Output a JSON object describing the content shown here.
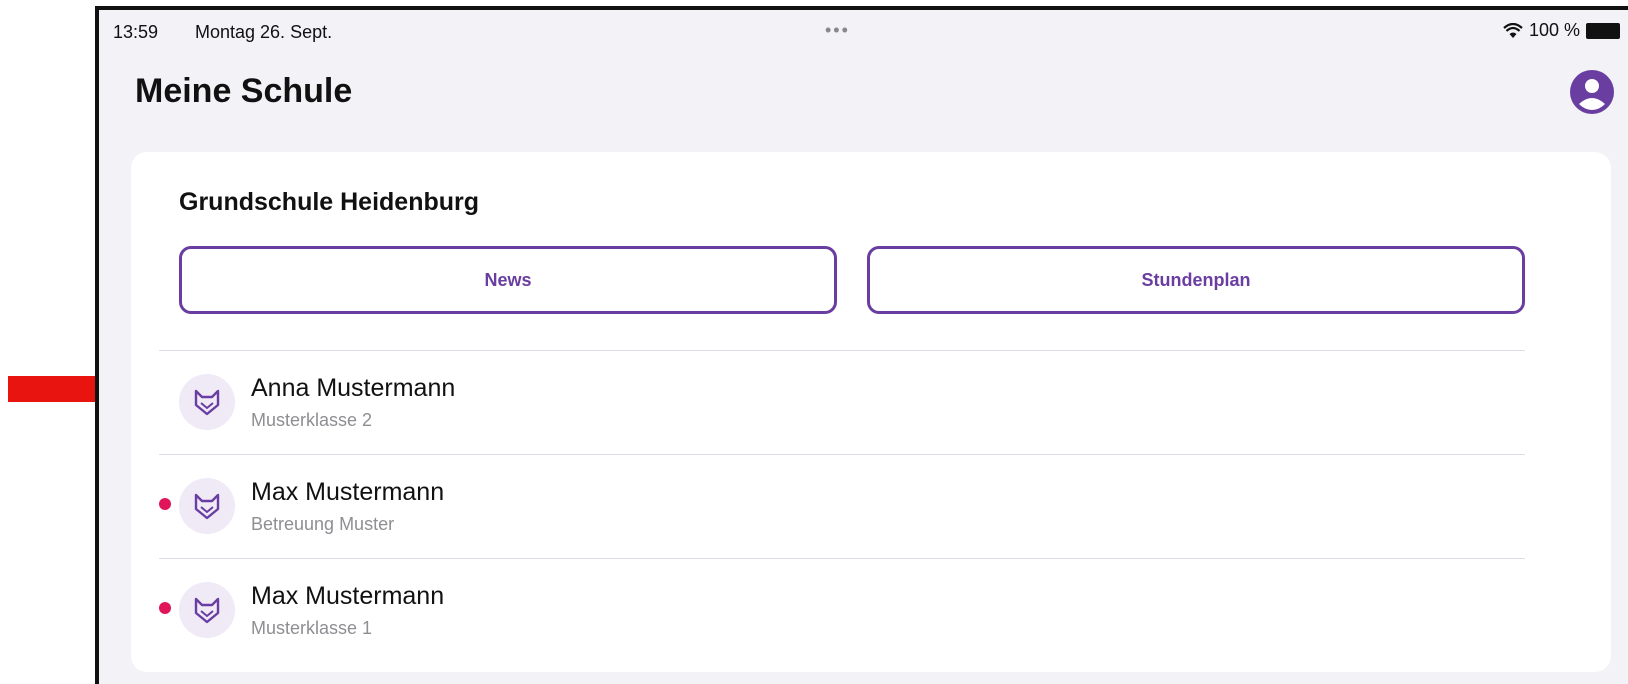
{
  "statusbar": {
    "time": "13:59",
    "date": "Montag 26. Sept.",
    "multitask_dots": "•••",
    "battery": "100 %",
    "icons": [
      "wifi-icon",
      "battery-icon"
    ]
  },
  "header": {
    "title": "Meine Schule",
    "profile_icon": "person-circle-icon"
  },
  "school": {
    "name": "Grundschule Heidenburg",
    "buttons": [
      {
        "label": "News"
      },
      {
        "label": "Stundenplan"
      }
    ]
  },
  "children": [
    {
      "name": "Anna Mustermann",
      "class": "Musterklasse 2",
      "unread": false,
      "icon": "fox-icon"
    },
    {
      "name": "Max Mustermann",
      "class": "Betreuung Muster",
      "unread": true,
      "icon": "fox-icon"
    },
    {
      "name": "Max Mustermann",
      "class": "Musterklasse 1",
      "unread": true,
      "icon": "fox-icon"
    }
  ],
  "annotation": {
    "icon": "red-arrow-icon"
  },
  "colors": {
    "accent": "#6a3ea1",
    "unread_dot": "#e0145a",
    "background": "#f2f2f7",
    "card": "#ffffff",
    "annotation_arrow": "#e8140f"
  }
}
